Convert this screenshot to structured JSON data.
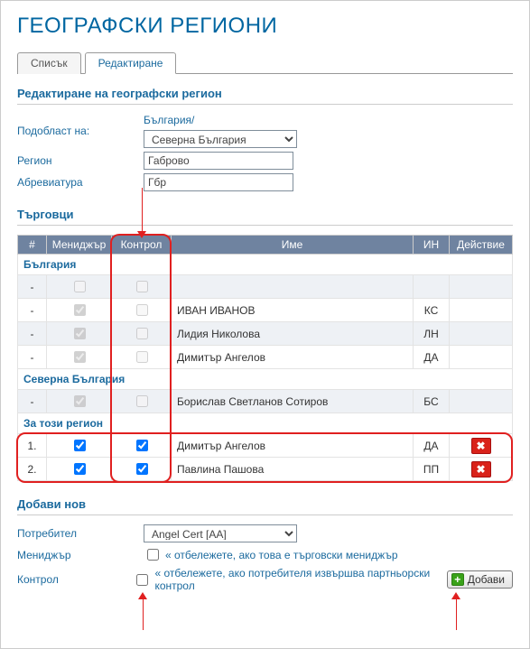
{
  "page_title": "ГЕОГРАФСКИ РЕГИОНИ",
  "tabs": {
    "list": "Списък",
    "edit": "Редактиране"
  },
  "section1_title": "Редактиране на географски регион",
  "form": {
    "subfield_label": "Подобласт на:",
    "crumb": "България/",
    "subfield_value": "Северна България",
    "subfield_options": [
      "Северна България"
    ],
    "region_label": "Регион",
    "region_value": "Габрово",
    "abbr_label": "Абревиатура",
    "abbr_value": "Гбр"
  },
  "salesmen_title": "Търговци",
  "grid": {
    "headers": {
      "num": "#",
      "manager": "Мениджър",
      "control": "Контрол",
      "name": "Име",
      "in": "ИН",
      "action": "Действие"
    },
    "groups": [
      {
        "title": "България",
        "rows": [
          {
            "num": "-",
            "manager": false,
            "control": false,
            "name": "",
            "in": "",
            "del": false
          },
          {
            "num": "-",
            "manager": true,
            "control": false,
            "name": "ИВАН ИВАНОВ",
            "in": "КС",
            "del": false
          },
          {
            "num": "-",
            "manager": true,
            "control": false,
            "name": "Лидия Николова",
            "in": "ЛН",
            "del": false
          },
          {
            "num": "-",
            "manager": true,
            "control": false,
            "name": "Димитър Ангелов",
            "in": "ДА",
            "del": false
          }
        ]
      },
      {
        "title": "Северна България",
        "rows": [
          {
            "num": "-",
            "manager": true,
            "control": false,
            "name": "Борислав Светланов Сотиров",
            "in": "БС",
            "del": false
          }
        ]
      },
      {
        "title": "За този регион",
        "rows": [
          {
            "num": "1.",
            "manager": true,
            "control": true,
            "name": "Димитър Ангелов",
            "in": "ДА",
            "del": true
          },
          {
            "num": "2.",
            "manager": true,
            "control": true,
            "name": "Павлина Пашова",
            "in": "ПП",
            "del": true
          }
        ]
      }
    ]
  },
  "addnew": {
    "title": "Добави нов",
    "user_label": "Потребител",
    "user_value": "Angel Cert [AA]",
    "user_options": [
      "Angel Cert [AA]"
    ],
    "manager_label": "Мениджър",
    "manager_hint": "« отбележете, ако това е търговски мениджър",
    "control_label": "Контрол",
    "control_hint": "« отбележете, ако потребителя извършва партньорски контрол",
    "add_btn": "Добави"
  }
}
